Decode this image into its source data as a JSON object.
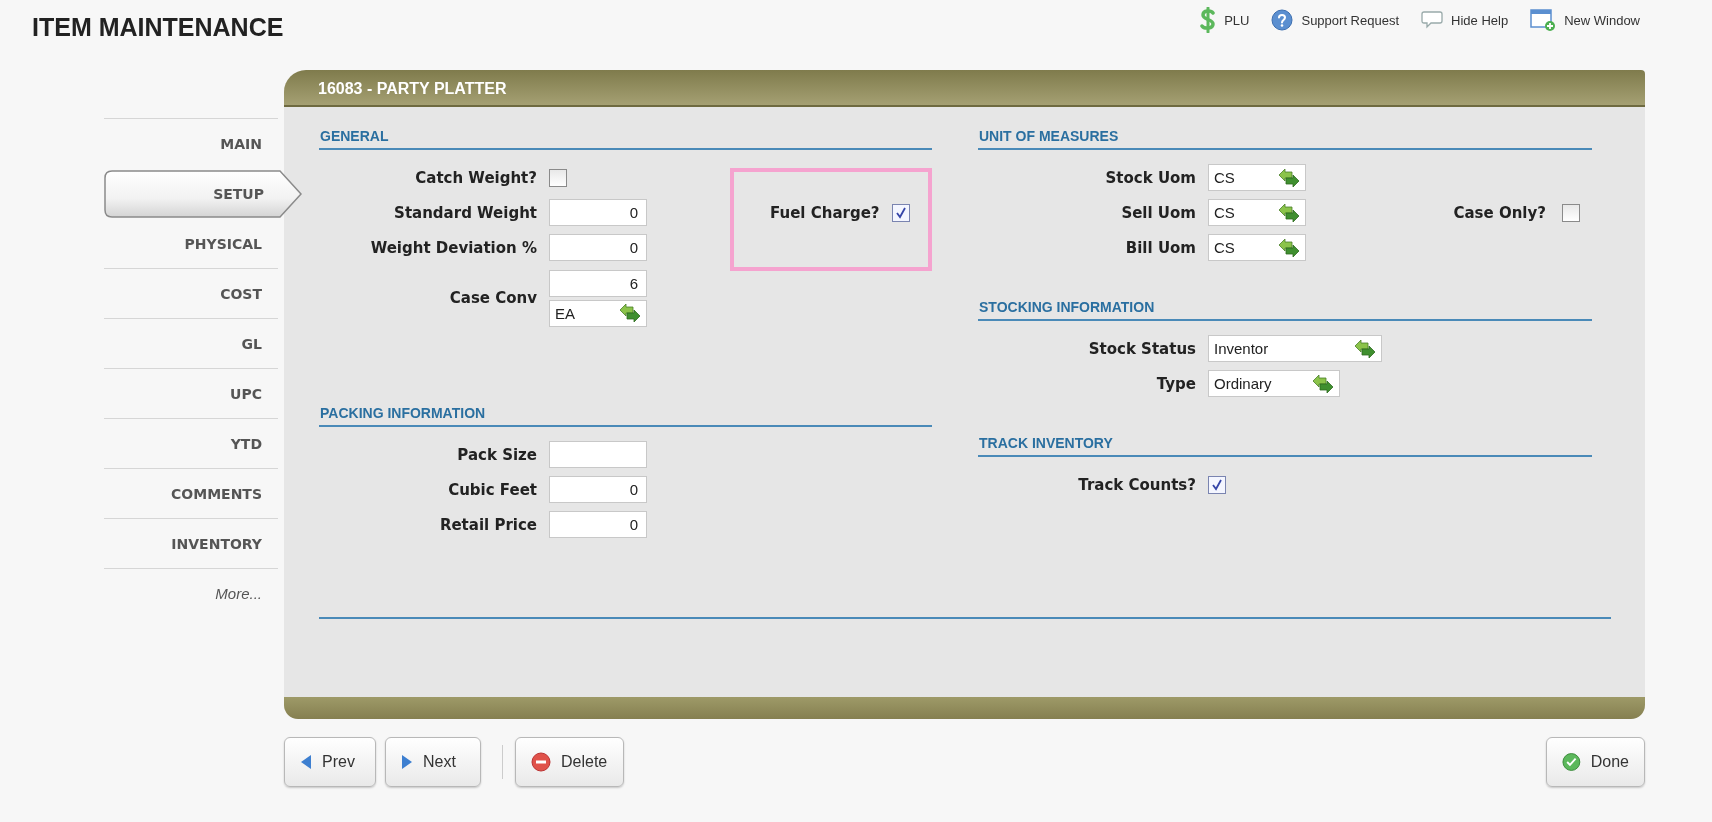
{
  "page_title": "ITEM MAINTENANCE",
  "header_links": [
    {
      "kind": "dollar",
      "label": "PLU"
    },
    {
      "kind": "help",
      "label": "Support Request"
    },
    {
      "kind": "bubble",
      "label": "Hide Help"
    },
    {
      "kind": "window",
      "label": "New Window"
    }
  ],
  "sidebar": {
    "items": [
      {
        "label": "MAIN",
        "selected": false
      },
      {
        "label": "SETUP",
        "selected": true
      },
      {
        "label": "PHYSICAL",
        "selected": false
      },
      {
        "label": "COST",
        "selected": false
      },
      {
        "label": "GL",
        "selected": false
      },
      {
        "label": "UPC",
        "selected": false
      },
      {
        "label": "YTD",
        "selected": false
      },
      {
        "label": "COMMENTS",
        "selected": false
      },
      {
        "label": "INVENTORY",
        "selected": false
      }
    ],
    "more_link": "More..."
  },
  "panel": {
    "title": "16083 - PARTY PLATTER",
    "left_sections": [
      {
        "title": "GENERAL",
        "fields": [
          {
            "label": "Catch Weight?",
            "kind": "checkbox",
            "checked": false
          },
          {
            "label": "Standard Weight",
            "kind": "number",
            "value": "0"
          },
          {
            "label": "Weight Deviation %",
            "kind": "number",
            "value": "0"
          },
          {
            "label": "Case Conv",
            "kind": "conversion",
            "value": "6",
            "unit": "EA"
          }
        ],
        "callout": {
          "highlighted": true,
          "fields": [
            {
              "label": "Fuel Charge?",
              "kind": "checkbox",
              "checked": true
            }
          ]
        }
      },
      {
        "title": "PACKING INFORMATION",
        "fields": [
          {
            "label": "Pack Size",
            "kind": "number"
          },
          {
            "label": "Cubic Feet",
            "kind": "number",
            "value": "0"
          },
          {
            "label": "Retail Price",
            "kind": "number",
            "value": "0"
          }
        ]
      }
    ],
    "right_sections": [
      {
        "title": "UNIT OF MEASURES",
        "fields": [
          {
            "label": "Stock Uom",
            "kind": "lookup",
            "value": "CS"
          },
          {
            "label": "Sell Uom",
            "kind": "lookup",
            "value": "CS"
          },
          {
            "label": "Bill Uom",
            "kind": "lookup",
            "value": "CS"
          }
        ],
        "side_fields": [
          {
            "label": "Case Only?",
            "kind": "checkbox",
            "checked": false
          }
        ]
      },
      {
        "title": "STOCKING INFORMATION",
        "fields": [
          {
            "label": "Stock Status",
            "kind": "longlookup",
            "value": "Inventor"
          },
          {
            "label": "Type",
            "kind": "midlookup",
            "value": "Ordinary"
          }
        ]
      },
      {
        "title": "TRACK INVENTORY",
        "fields": [
          {
            "label": "Track Counts?",
            "kind": "checkbox",
            "checked": true
          }
        ]
      }
    ]
  },
  "buttons": [
    {
      "kind": "prev",
      "label": "Prev"
    },
    {
      "kind": "next",
      "label": "Next"
    },
    {
      "kind": "delete",
      "label": "Delete"
    },
    {
      "kind": "done",
      "label": "Done"
    }
  ]
}
